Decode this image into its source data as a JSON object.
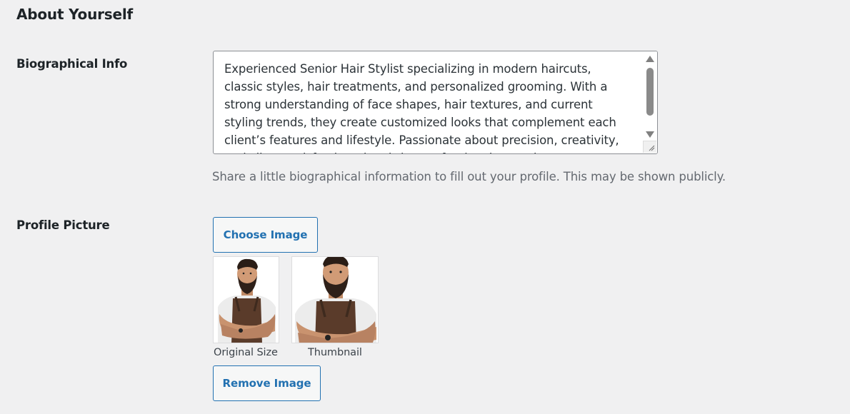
{
  "section": {
    "title": "About Yourself"
  },
  "bio": {
    "label": "Biographical Info",
    "value": "Experienced Senior Hair Stylist specializing in modern haircuts, classic styles, hair treatments, and personalized grooming. With a strong understanding of face shapes, hair textures, and current styling trends, they create customized looks that complement each client’s features and lifestyle. Passionate about precision, creativity, and client satisfaction, they bring professional expertise to every styling session.",
    "description": "Share a little biographical information to fill out your profile. This may be shown publicly."
  },
  "profile_picture": {
    "label": "Profile Picture",
    "choose_label": "Choose Image",
    "remove_label": "Remove Image",
    "previews": [
      {
        "caption": "Original Size",
        "image": "barber-portrait"
      },
      {
        "caption": "Thumbnail",
        "image": "barber-portrait"
      }
    ]
  },
  "colors": {
    "background": "#f0f0f1",
    "accent": "#2271b1",
    "text": "#1d2327",
    "muted": "#646970"
  },
  "icons": [
    "scroll-up-arrow-icon",
    "scroll-down-arrow-icon",
    "resize-grip-icon"
  ]
}
